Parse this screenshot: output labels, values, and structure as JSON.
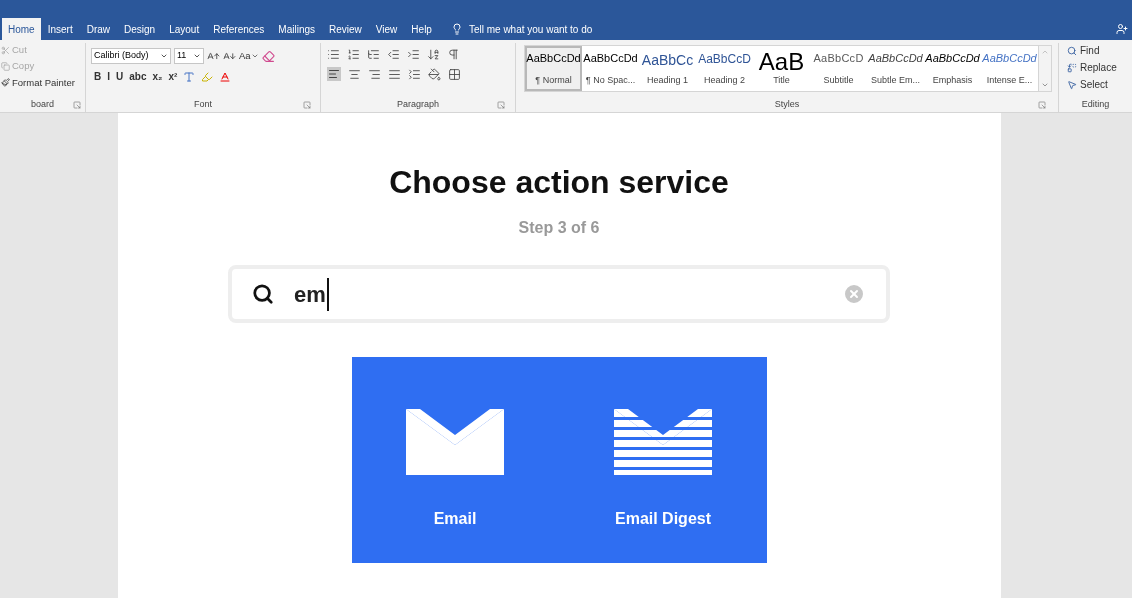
{
  "tabs": [
    {
      "label": "Home",
      "selected": true
    },
    {
      "label": "Insert",
      "selected": false
    },
    {
      "label": "Draw",
      "selected": false
    },
    {
      "label": "Design",
      "selected": false
    },
    {
      "label": "Layout",
      "selected": false
    },
    {
      "label": "References",
      "selected": false
    },
    {
      "label": "Mailings",
      "selected": false
    },
    {
      "label": "Review",
      "selected": false
    },
    {
      "label": "View",
      "selected": false
    },
    {
      "label": "Help",
      "selected": false
    }
  ],
  "tell_me": "Tell me what you want to do",
  "clipboard": {
    "items": [
      {
        "label": "Cut",
        "disabled": true
      },
      {
        "label": "Copy",
        "disabled": true
      },
      {
        "label": "Format Painter",
        "disabled": false
      }
    ],
    "group_label": "board"
  },
  "font": {
    "family": "Calibri (Body)",
    "size": "11",
    "case_button": "Aa",
    "format_buttons": [
      "B",
      "I",
      "U",
      "abc",
      "x₂",
      "x²"
    ],
    "group_label": "Font"
  },
  "paragraph": {
    "group_label": "Paragraph"
  },
  "styles": {
    "items": [
      {
        "sample": "AaBbCcDd",
        "name": "¶ Normal",
        "kind": "normal",
        "selected": true
      },
      {
        "sample": "AaBbCcDd",
        "name": "¶ No Spac...",
        "kind": "normal",
        "selected": false
      },
      {
        "sample": "AaBbCc",
        "name": "Heading 1",
        "kind": "heading1",
        "selected": false
      },
      {
        "sample": "AaBbCcD",
        "name": "Heading 2",
        "kind": "heading2",
        "selected": false
      },
      {
        "sample": "AaB",
        "name": "Title",
        "kind": "title",
        "selected": false
      },
      {
        "sample": "AaBbCcD",
        "name": "Subtitle",
        "kind": "subtitle",
        "selected": false
      },
      {
        "sample": "AaBbCcDd",
        "name": "Subtle Em...",
        "kind": "subtle",
        "selected": false
      },
      {
        "sample": "AaBbCcDd",
        "name": "Emphasis",
        "kind": "emphasis",
        "selected": false
      },
      {
        "sample": "AaBbCcDd",
        "name": "Intense E...",
        "kind": "intense",
        "selected": false
      }
    ],
    "group_label": "Styles"
  },
  "editing": {
    "items": [
      {
        "label": "Find",
        "kind": "find"
      },
      {
        "label": "Replace",
        "kind": "replace"
      },
      {
        "label": "Select",
        "kind": "select"
      }
    ],
    "group_label": "Editing"
  },
  "document": {
    "heading": "Choose action service",
    "step": "Step 3 of 6",
    "search": {
      "value": "em"
    },
    "services": [
      {
        "name": "Email",
        "kind": "envelope"
      },
      {
        "name": "Email Digest",
        "kind": "striped-envelope"
      }
    ]
  }
}
